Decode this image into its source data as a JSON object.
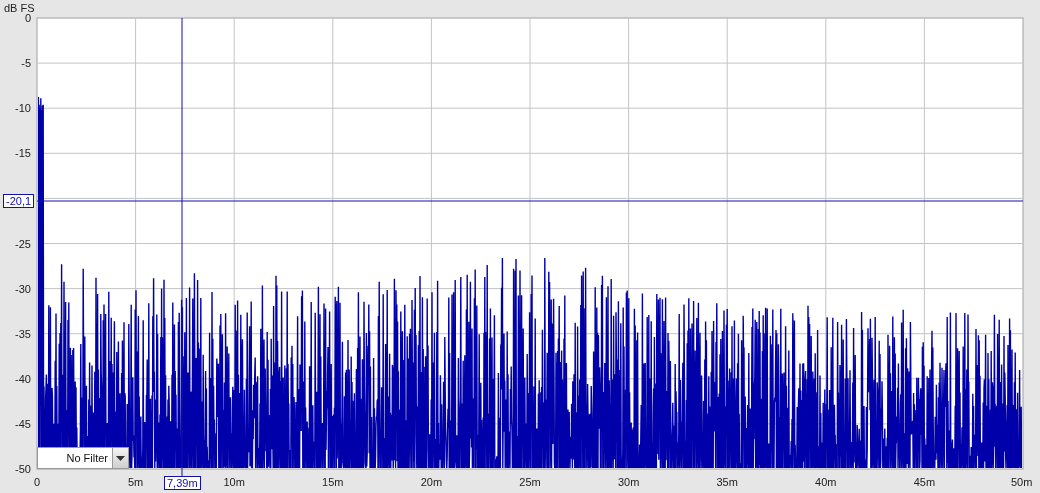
{
  "y_axis": {
    "title": "dB FS",
    "ticks": [
      {
        "label": "0",
        "covered": false
      },
      {
        "label": "-5",
        "covered": false
      },
      {
        "label": "-10",
        "covered": false
      },
      {
        "label": "-15",
        "covered": false
      },
      {
        "covered": true
      },
      {
        "label": "-25",
        "covered": false
      },
      {
        "label": "-30",
        "covered": false
      },
      {
        "label": "-35",
        "covered": false
      },
      {
        "label": "-40",
        "covered": false
      },
      {
        "label": "-45",
        "covered": false
      },
      {
        "label": "-50",
        "covered": false
      }
    ]
  },
  "x_axis": {
    "ticks": [
      "0",
      "5m",
      "10m",
      "15m",
      "20m",
      "25m",
      "30m",
      "35m",
      "40m",
      "45m",
      "50m"
    ]
  },
  "cursor": {
    "x_readout": "7,39m",
    "y_readout": "-20,1"
  },
  "filter_dropdown": {
    "value": "No Filter"
  }
}
